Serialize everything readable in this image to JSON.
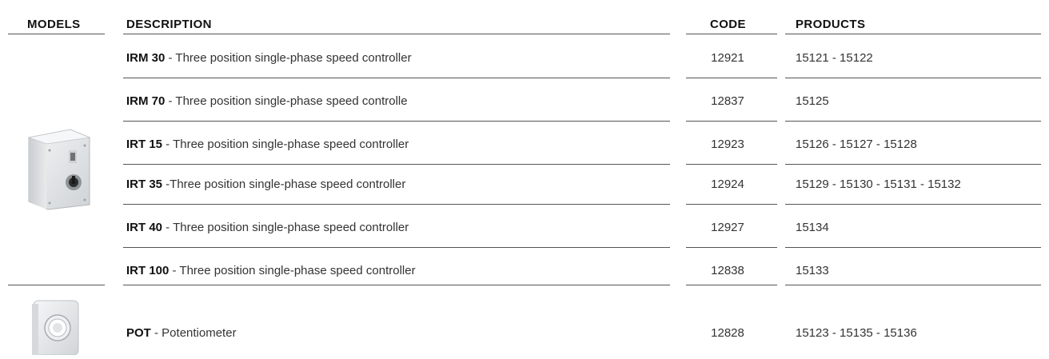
{
  "headers": {
    "models": "MODELS",
    "description": "DESCRIPTION",
    "code": "CODE",
    "products": "PRODUCTS"
  },
  "rows": [
    {
      "model": "IRM 30",
      "description": " - Three position single-phase speed controller",
      "code": "12921",
      "products": "15121 - 15122"
    },
    {
      "model": "IRM 70",
      "description": " - Three position single-phase speed controlle",
      "code": "12837",
      "products": "15125"
    },
    {
      "model": "IRT 15",
      "description": " - Three position single-phase speed controller",
      "code": "12923",
      "products": "15126 - 15127 - 15128"
    },
    {
      "model": "IRT 35",
      "description": " -Three position single-phase speed controller",
      "code": "12924",
      "products": "15129 - 15130 - 15131 - 15132"
    },
    {
      "model": "IRT 40",
      "description": " - Three position single-phase speed controller",
      "code": "12927",
      "products": "15134"
    },
    {
      "model": "IRT 100",
      "description": " - Three position single-phase speed controller",
      "code": "12838",
      "products": "15133"
    },
    {
      "model": "POT",
      "description": " - Potentiometer",
      "code": "12828",
      "products": "15123 - 15135 - 15136"
    }
  ],
  "colors": {
    "rule": "#555555",
    "device_body": "#e6e8ea",
    "device_knob": "#2c2c2c"
  },
  "icons": {
    "group1": "speed-controller-box-image",
    "group2": "potentiometer-image"
  }
}
